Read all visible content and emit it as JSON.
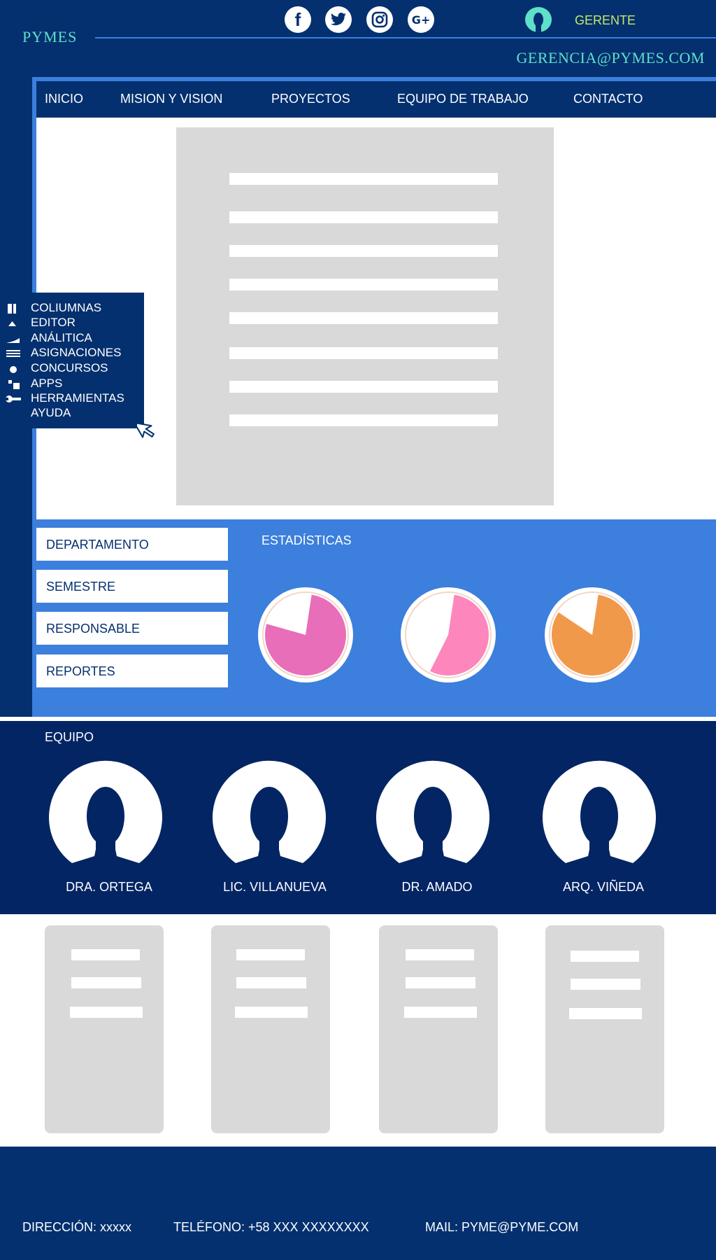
{
  "header": {
    "brand": "PYMES",
    "social": [
      "facebook-icon",
      "twitter-icon",
      "instagram-icon",
      "google-plus-icon"
    ],
    "social_glyphs": {
      "facebook": "f",
      "google_plus": "G+"
    },
    "user_role": "GERENTE",
    "email": "GERENCIA@PYMES.COM"
  },
  "nav": {
    "items": [
      {
        "label": "INICIO"
      },
      {
        "label": "MISION Y VISION"
      },
      {
        "label": "PROYECTOS"
      },
      {
        "label": "EQUIPO DE TRABAJO"
      },
      {
        "label": "CONTACTO"
      }
    ]
  },
  "side_menu": {
    "items": [
      {
        "label": "COLIUMNAS",
        "icon": "columns-icon"
      },
      {
        "label": "EDITOR",
        "icon": "triangle-icon"
      },
      {
        "label": "ANÁLITICA",
        "icon": "area-chart-icon"
      },
      {
        "label": "ASIGNACIONES",
        "icon": "lines-icon"
      },
      {
        "label": "CONCURSOS",
        "icon": "dot-icon"
      },
      {
        "label": "APPS",
        "icon": "apps-icon"
      },
      {
        "label": "HERRAMIENTAS",
        "icon": "wrench-icon"
      },
      {
        "label": "AYUDA",
        "icon": ""
      }
    ]
  },
  "filters": {
    "items": [
      {
        "label": "DEPARTAMENTO"
      },
      {
        "label": "SEMESTRE"
      },
      {
        "label": "RESPONSABLE"
      },
      {
        "label": "REPORTES"
      }
    ]
  },
  "stats": {
    "title": "ESTADÍSTICAS",
    "pies": [
      {
        "fraction": 0.77,
        "color": "#e86eb9"
      },
      {
        "fraction": 0.55,
        "color": "#fd86bd"
      },
      {
        "fraction": 0.82,
        "color": "#f0994b"
      }
    ]
  },
  "team": {
    "title": "EQUIPO",
    "members": [
      {
        "name": "DRA. ORTEGA"
      },
      {
        "name": "LIC. VILLANUEVA"
      },
      {
        "name": "DR. AMADO"
      },
      {
        "name": "ARQ. VIÑEDA"
      }
    ]
  },
  "footer": {
    "address": "DIRECCIÓN: xxxxx",
    "phone": "TELÉFONO: +58 XXX XXXXXXXX",
    "mail": "MAIL: PYME@PYME.COM"
  },
  "colors": {
    "navy": "#04306f",
    "dark_navy": "#032564",
    "blue": "#3c7fdd",
    "teal": "#5fe0c9",
    "lime": "#c6e86d",
    "placeholder_gray": "#d9d9d9"
  }
}
